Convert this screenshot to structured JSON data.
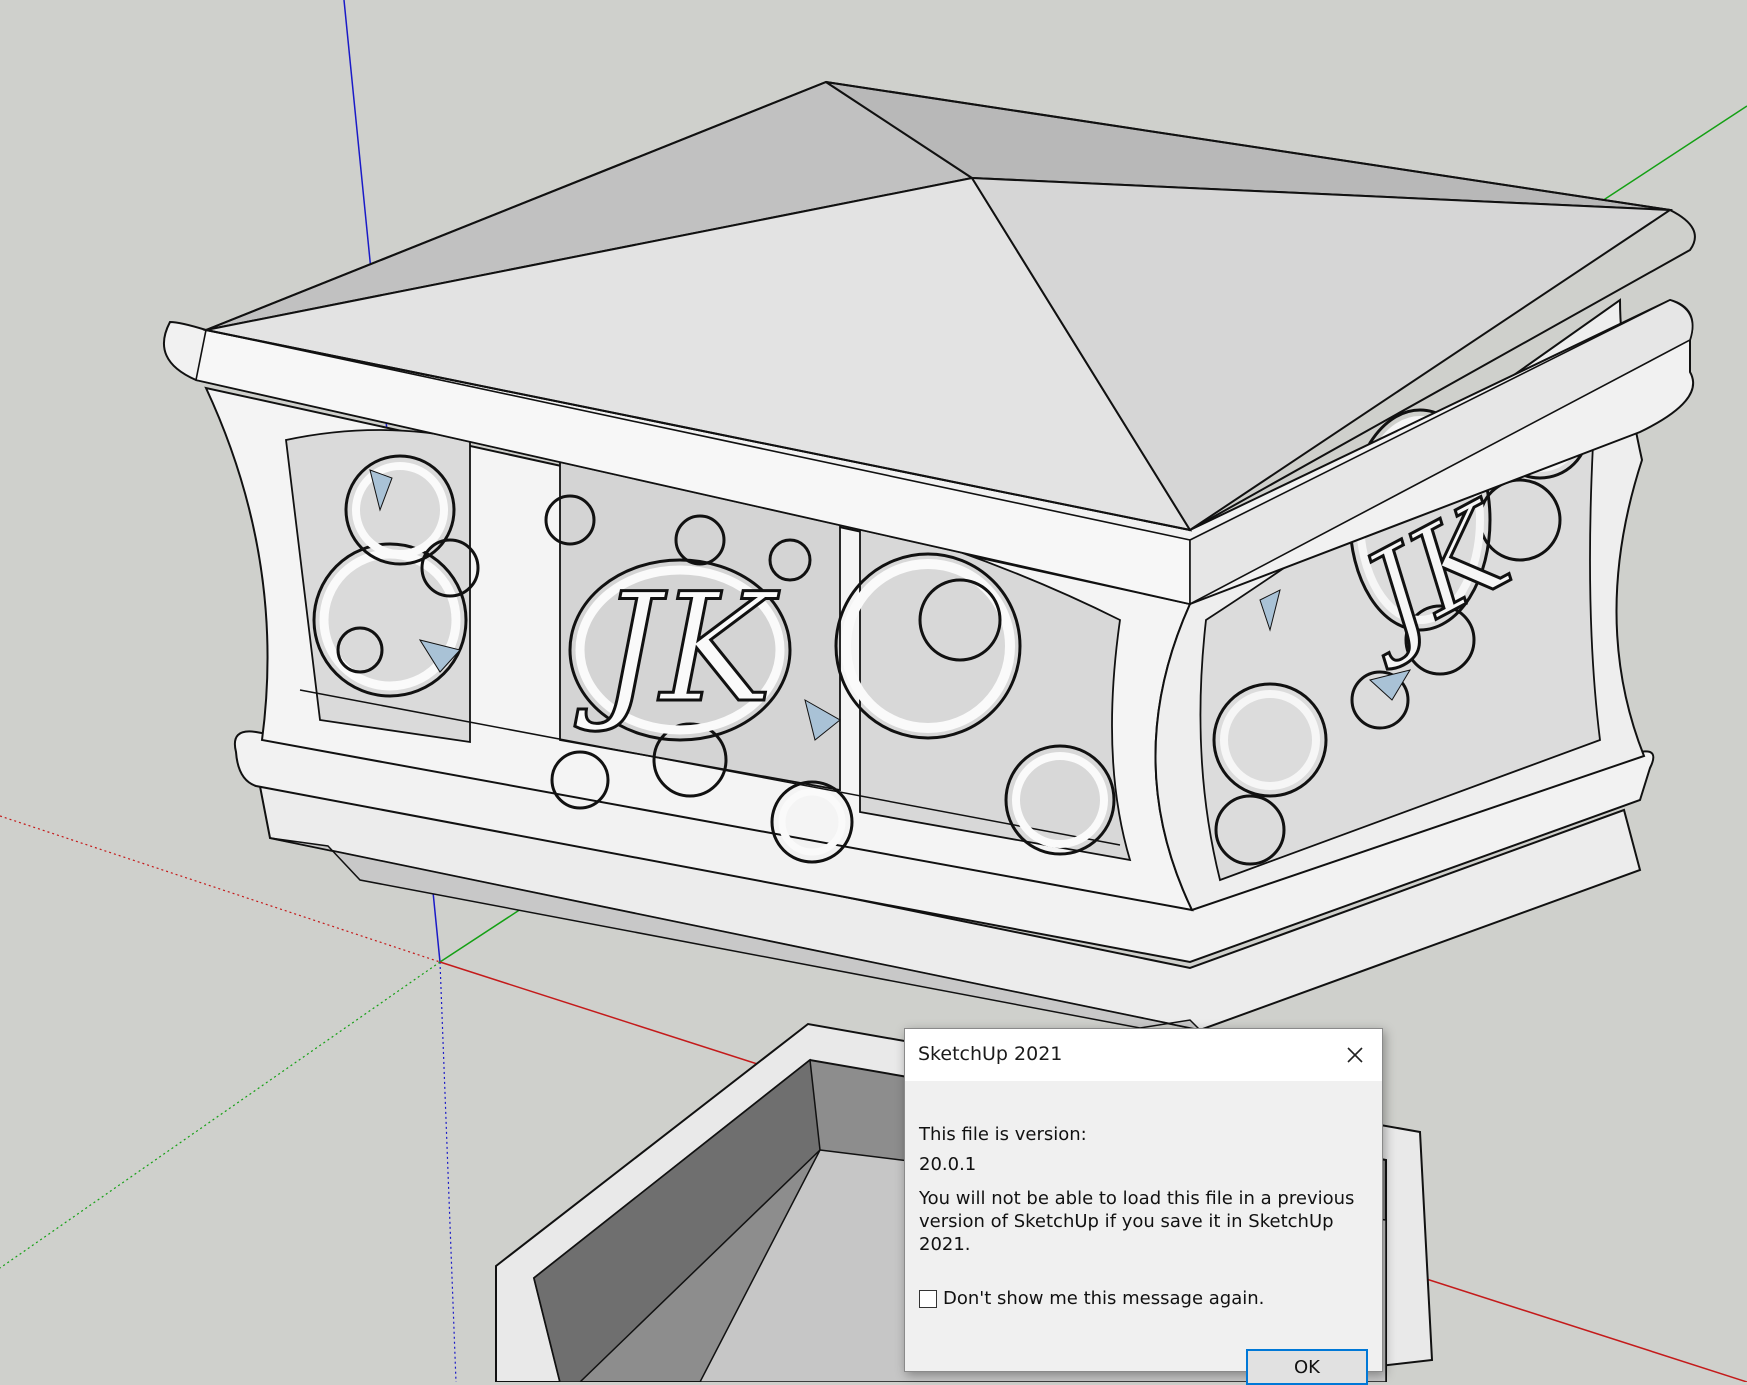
{
  "dialog": {
    "title": "SketchUp 2021",
    "close_icon": "close-icon",
    "version_label": "This file is version:",
    "version_value": "20.0.1",
    "message": "You will not be able to load this file in a previous version of SketchUp if you save it in SketchUp 2021.",
    "dont_show_label": "Don't show me this message again.",
    "dont_show_checked": false,
    "ok_label": "OK"
  },
  "colors": {
    "background": "#cfd0cc",
    "axis_red": "#c41a1a",
    "axis_green": "#14a014",
    "axis_blue": "#1a1ac8",
    "dialog_accent": "#0078d7"
  }
}
